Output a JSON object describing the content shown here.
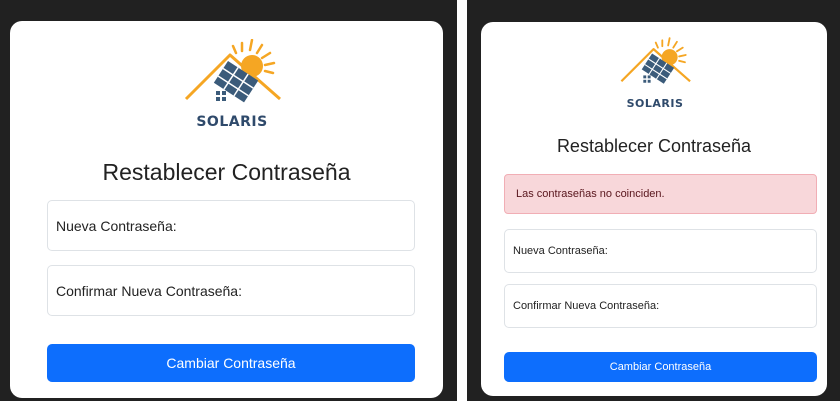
{
  "brand": {
    "name": "SOLARIS"
  },
  "left_form": {
    "title": "Restablecer Contraseña",
    "new_password_placeholder": "Nueva Contraseña:",
    "confirm_password_placeholder": "Confirmar Nueva Contraseña:",
    "submit_label": "Cambiar Contraseña"
  },
  "right_form": {
    "title": "Restablecer Contraseña",
    "error_message": "Las contraseñas no coinciden.",
    "new_password_placeholder": "Nueva Contraseña:",
    "confirm_password_placeholder": "Confirmar Nueva Contraseña:",
    "submit_label": "Cambiar Contraseña"
  },
  "colors": {
    "primary_button": "#0d6efd",
    "error_background": "#f8d7da",
    "logo_text": "#2f4a6b",
    "sun": "#f5a623",
    "panel_blue": "#3b5b7a"
  }
}
